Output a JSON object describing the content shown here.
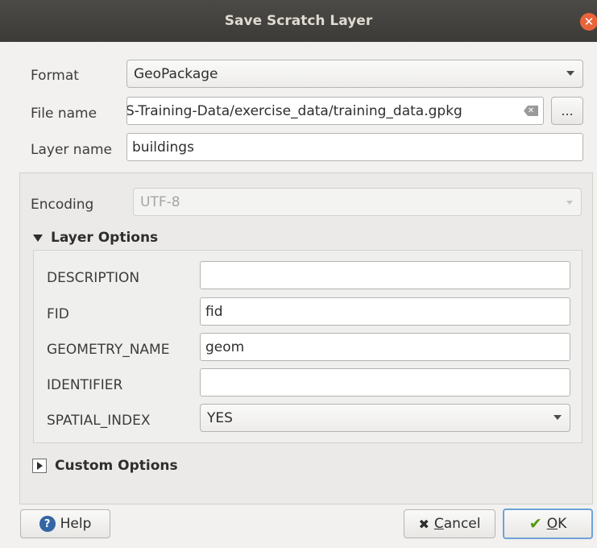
{
  "window": {
    "title": "Save Scratch Layer"
  },
  "form": {
    "format_label": "Format",
    "format_value": "GeoPackage",
    "filename_label": "File name",
    "filename_value": "S-Training-Data/exercise_data/training_data.gpkg",
    "browse_label": "...",
    "layername_label": "Layer name",
    "layername_value": "buildings"
  },
  "options": {
    "encoding_label": "Encoding",
    "encoding_value": "UTF-8",
    "layer_options_title": "Layer Options",
    "rows": [
      {
        "label": "DESCRIPTION",
        "value": ""
      },
      {
        "label": "FID",
        "value": "fid"
      },
      {
        "label": "GEOMETRY_NAME",
        "value": "geom"
      },
      {
        "label": "IDENTIFIER",
        "value": ""
      },
      {
        "label": "SPATIAL_INDEX",
        "value": "YES"
      }
    ],
    "custom_options_title": "Custom Options"
  },
  "buttons": {
    "help": "Help",
    "cancel_accel": "C",
    "cancel_rest": "ancel",
    "ok_accel": "O",
    "ok_rest": "K"
  }
}
